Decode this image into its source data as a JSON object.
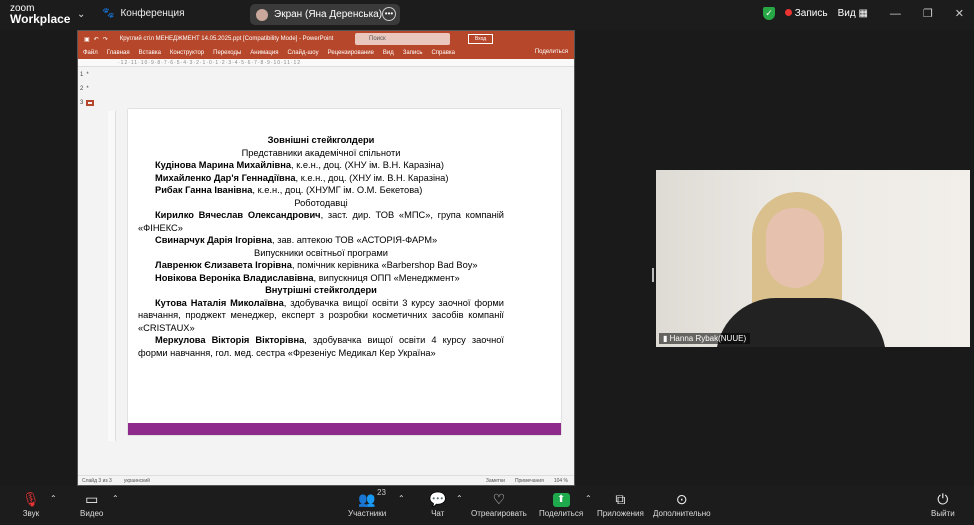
{
  "app": {
    "brand_line1": "zoom",
    "brand_line2": "Workplace",
    "meeting": "Конференция"
  },
  "screen_share": {
    "label": "Экран (Яна Деренська)"
  },
  "top_right": {
    "record": "Запись",
    "view": "Вид"
  },
  "ppt": {
    "title": "Круглий стіл МЕНЕДЖМЕНТ 14.05.2025.ppt [Compatibility Mode] - PowerPoint",
    "search_placeholder": "Поиск",
    "login": "Вход",
    "share": "Поделиться",
    "menu": [
      "Файл",
      "Главная",
      "Вставка",
      "Конструктор",
      "Переходы",
      "Анимация",
      "Слайд-шоу",
      "Рецензирование",
      "Вид",
      "Запись",
      "Справка"
    ],
    "thumbs": [
      "1",
      "2",
      "3"
    ],
    "status_slide": "Слайд 3 из 3",
    "status_lang": "украинский",
    "status_notes": "Заметки",
    "status_comments": "Примечания",
    "status_zoom": "104 %"
  },
  "slide": {
    "h1": "Зовнішні стейкголдери",
    "sub1": "Представники академічної спільноти",
    "p1_name": "Кудінова Марина Михайлівна",
    "p1_rest": ", к.е.н., доц. (ХНУ ім. В.Н. Каразіна)",
    "p2_name": "Михайленко Дар'я Геннадіївна",
    "p2_rest": ", к.е.н., доц. (ХНУ ім. В.Н. Каразіна)",
    "p3_name": "Рибак Ганна Іванівна",
    "p3_rest": ", к.е.н., доц. (ХНУМГ ім. О.М. Бекетова)",
    "sub2": "Роботодавці",
    "p4_name": "Кирилко Вячеслав Олександрович",
    "p4_rest": ", заст. дир. ТОВ «МПС», група компаній «ФІНЕКС»",
    "p5_name": "Свинарчук Дарія Ігорівна",
    "p5_rest": ", зав. аптекою ТОВ «АСТОРІЯ-ФАРМ»",
    "sub3": "Випускники освітньої програми",
    "p6_name": "Лавренюк Єлизавета Ігорівна",
    "p6_rest": ", помічник керівника «Barbershop Bad Boy»",
    "p7_name": "Новікова Вероніка Владиславівна",
    "p7_rest": ", випускниця ОПП «Менеджмент»",
    "h2": "Внутрішні стейкголдери",
    "p8_name": "Кутова Наталія Миколаївна",
    "p8_rest": ", здобувачка вищої освіти 3 курсу заочної форми навчання, проджект менеджер, експерт з розробки косметичних засобів компанії «CRISTAUX»",
    "p9_name": "Меркулова Вікторія Вікторівна",
    "p9_rest": ", здобувачка вищої освіти 4 курсу заочної форми навчання, гол. мед. сестра «Фрезеніус Медикал Кер Україна»"
  },
  "video": {
    "name": "Hanna Rybak(NUUE)"
  },
  "toolbar": {
    "audio": "Звук",
    "video": "Видео",
    "participants": "Участники",
    "participants_count": "23",
    "chat": "Чат",
    "react": "Отреагировать",
    "share": "Поделиться",
    "apps": "Приложения",
    "more": "Дополнительно",
    "leave": "Выйти"
  },
  "colors": {
    "ppt_accent": "#b7472a",
    "slide_band": "#8e2a8b",
    "share_green": "#1ea94c"
  }
}
